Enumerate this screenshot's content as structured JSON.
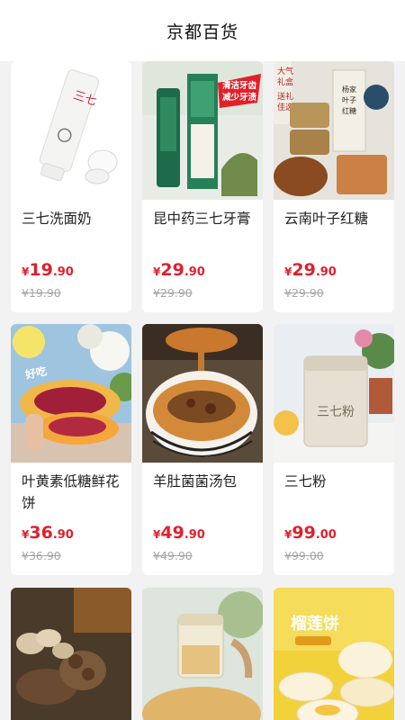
{
  "header": {
    "title": "京都百货"
  },
  "products": [
    {
      "name": "三七洗面奶",
      "currency": "¥",
      "price_int": "19",
      "price_dec": ".90",
      "original": "¥19.90",
      "image_label": "三七"
    },
    {
      "name": "昆中药三七牙膏",
      "currency": "¥",
      "price_int": "29",
      "price_dec": ".90",
      "original": "¥29.90",
      "image_label": "清洁牙齿 减少牙渍"
    },
    {
      "name": "云南叶子红糖",
      "currency": "¥",
      "price_int": "29",
      "price_dec": ".90",
      "original": "¥29.90",
      "image_label": "大气礼盒 送礼佳选 杨家叶子红糖"
    },
    {
      "name": "叶黄素低糖鲜花饼",
      "currency": "¥",
      "price_int": "36",
      "price_dec": ".90",
      "original": "¥36.90",
      "image_label": "好吃"
    },
    {
      "name": "羊肚菌菌汤包",
      "currency": "¥",
      "price_int": "49",
      "price_dec": ".90",
      "original": "¥49.90",
      "image_label": ""
    },
    {
      "name": "三七粉",
      "currency": "¥",
      "price_int": "99",
      "price_dec": ".00",
      "original": "¥99.00",
      "image_label": "三七粉"
    },
    {
      "name": "",
      "image_label": ""
    },
    {
      "name": "",
      "image_label": ""
    },
    {
      "name": "",
      "image_label": "榴莲饼"
    }
  ],
  "colors": {
    "price": "#e0202d",
    "strike": "#a5a5a5",
    "background": "#f2f2f2"
  }
}
